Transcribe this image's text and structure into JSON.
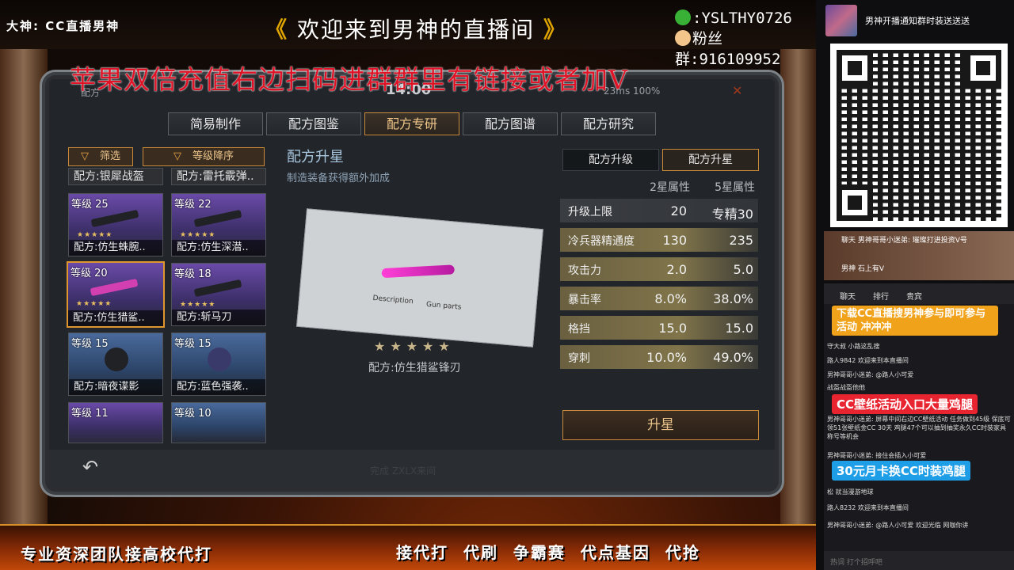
{
  "banner": {
    "host_label": "大神: CC直播男神",
    "welcome_left": "《",
    "welcome_text": "欢迎来到男神的直播间",
    "welcome_right": "》",
    "wechat_id": ":YSLTHY0726",
    "fan_group": "粉丝群:916109952",
    "promo_red": "苹果双倍充值右边扫码进群群里有链接或者加V"
  },
  "game": {
    "status_title": "配方",
    "time": "14:00",
    "network": "23ms 100%",
    "tabs": [
      "简易制作",
      "配方图鉴",
      "配方专研",
      "配方图谱",
      "配方研究"
    ],
    "active_tab_index": 2,
    "filter_label": "筛选",
    "sort_label": "等级降序",
    "top_cards": [
      "配方:银犀战盔",
      "配方:雷托霰弹.."
    ],
    "cards": [
      {
        "level": "等级 25",
        "name": "配方:仿生蛛腕..",
        "stars": "★★★★★"
      },
      {
        "level": "等级 22",
        "name": "配方:仿生深潜..",
        "stars": "★★★★★"
      },
      {
        "level": "等级 20",
        "name": "配方:仿生猎鲨..",
        "stars": "★★★★★"
      },
      {
        "level": "等级 18",
        "name": "配方:斩马刀",
        "stars": "★★★★★"
      },
      {
        "level": "等级 15",
        "name": "配方:暗夜谍影",
        "stars": ""
      },
      {
        "level": "等级 15",
        "name": "配方:蓝色强袭..",
        "stars": ""
      },
      {
        "level": "等级 11",
        "name": "",
        "stars": ""
      },
      {
        "level": "等级 10",
        "name": "",
        "stars": ""
      }
    ],
    "selected_card_index": 2,
    "detail_title": "配方升星",
    "detail_subtitle": "制造装备获得额外加成",
    "blueprint_text_1": "Description",
    "blueprint_text_2": "Gun parts",
    "detail_stars": "★★★★★",
    "recipe_name": "配方:仿生猎鲨锋刃",
    "sub_tabs": [
      "配方升级",
      "配方升星"
    ],
    "active_sub_tab_index": 1,
    "col_2star": "2星属性",
    "col_5star": "5星属性",
    "stats": [
      {
        "name": "升级上限",
        "v2": "20",
        "v5": "专精30",
        "highlight": false
      },
      {
        "name": "冷兵器精通度",
        "v2": "130",
        "v5": "235",
        "highlight": true
      },
      {
        "name": "攻击力",
        "v2": "2.0",
        "v5": "5.0",
        "highlight": true
      },
      {
        "name": "暴击率",
        "v2": "8.0%",
        "v5": "38.0%",
        "highlight": true
      },
      {
        "name": "格挡",
        "v2": "15.0",
        "v5": "15.0",
        "highlight": true
      },
      {
        "name": "穿刺",
        "v2": "10.0%",
        "v5": "49.0%",
        "highlight": true
      }
    ],
    "star_button": "升星",
    "back_icon": "↶",
    "bottom_faint": "完成 ZXLX来间"
  },
  "bottom_banner": {
    "left": "专业资深团队接高校代打",
    "right": "接代打 代刷 争霸赛 代点基因 代抢"
  },
  "right": {
    "notify_text": "男神开播通知群时装送送送",
    "mini_line1": "聊天 男神哥哥小迷弟: 璀璨打进投资V号",
    "mini_line2": "男神 石上有V",
    "chat_tabs": [
      "聊天",
      "排行",
      "贵宾"
    ],
    "overlay_1": "下载CC直播搜男神参与即可参与活动 冲冲冲",
    "overlay_2": "CC壁纸活动入口大量鸡腿",
    "overlay_3": "30元月卡换CC时装鸡腿",
    "messages": [
      "守大叔 小路这乱搜",
      "路人9842 欢迎来到本直播间",
      "男神哥哥小迷弟: @路人小可爱",
      "战盔战盔他他",
      "男神哥哥小迷弟: 屏幕中间右边CC壁纸活动 任务做到45级 保底可领51张壁纸金CC 30天 鸡腿47个可以抽到抽奖永久CC时装家具称号等机会",
      "男神哥哥小迷弟: 接住会插入小可爱",
      "松 就当漫游地球",
      "路人8232 欢迎来到本直播间",
      "男神哥哥小迷弟: @路人小可爱 欢迎光临 网咖你讲"
    ],
    "input_placeholder": "热词 打个招呼吧"
  }
}
